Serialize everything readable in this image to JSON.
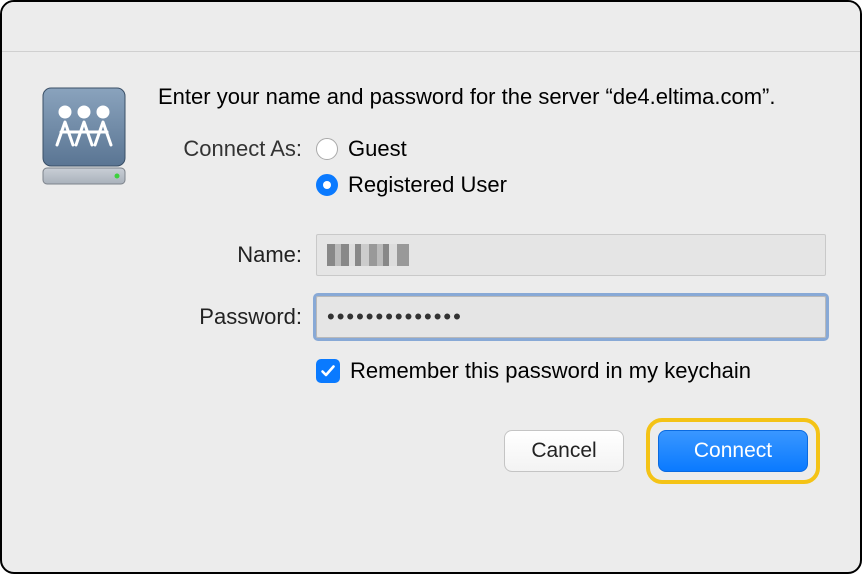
{
  "prompt": "Enter your name and password for the server “de4.eltima.com”.",
  "connect_as_label": "Connect As:",
  "radio": {
    "guest": {
      "label": "Guest",
      "selected": false
    },
    "registered": {
      "label": "Registered User",
      "selected": true
    }
  },
  "fields": {
    "name": {
      "label": "Name:",
      "value": ""
    },
    "password": {
      "label": "Password:",
      "value": "••••••••••••••"
    }
  },
  "remember": {
    "label": "Remember this password in my keychain",
    "checked": true
  },
  "buttons": {
    "cancel": "Cancel",
    "connect": "Connect"
  },
  "icon": "network-server-icon",
  "colors": {
    "accent": "#0a7aff",
    "highlight": "#f4c316"
  }
}
